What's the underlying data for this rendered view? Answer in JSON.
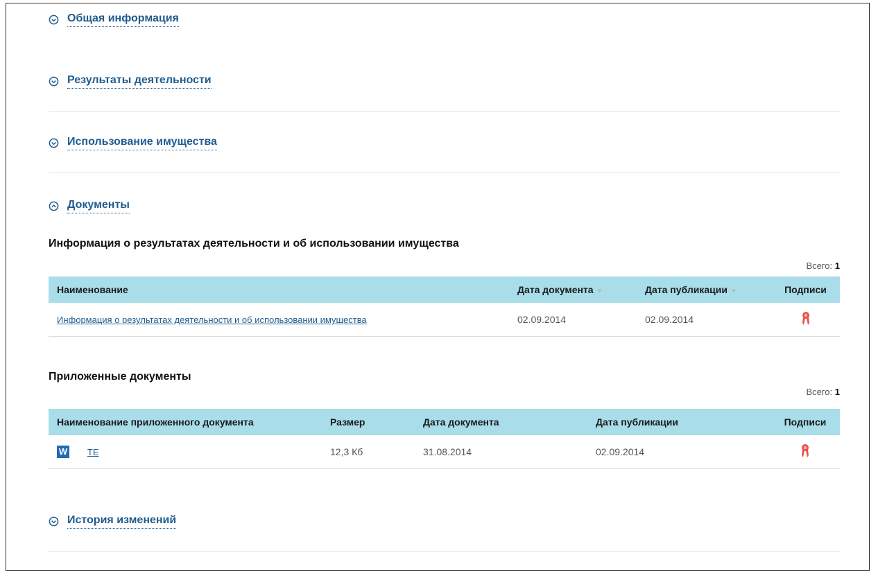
{
  "sections": {
    "general": "Общая информация",
    "results": "Результаты деятельности",
    "property": "Использование имущества",
    "documents": "Документы",
    "history": "История изменений"
  },
  "info_block": {
    "title": "Информация о результатах деятельности и об использовании имущества",
    "total_label": "Всего:",
    "total_value": "1",
    "columns": {
      "name": "Наименование",
      "doc_date": "Дата документа",
      "pub_date": "Дата публикации",
      "signatures": "Подписи"
    },
    "rows": [
      {
        "name": "Информация о результатах деятельности и об использовании имущества",
        "doc_date": "02.09.2014",
        "pub_date": "02.09.2014"
      }
    ]
  },
  "attached_block": {
    "title": "Приложенные документы",
    "total_label": "Всего:",
    "total_value": "1",
    "columns": {
      "name": "Наименование приложенного документа",
      "size": "Размер",
      "doc_date": "Дата документа",
      "pub_date": "Дата публикации",
      "signatures": "Подписи"
    },
    "rows": [
      {
        "icon": "W",
        "name": "ТЕ",
        "size": "12,3 Кб",
        "doc_date": "31.08.2014",
        "pub_date": "02.09.2014"
      }
    ]
  },
  "colors": {
    "header_bg": "#a8dde9",
    "link": "#1f5c8f",
    "signature": "#e8524a",
    "word_icon": "#1f6bb5"
  }
}
